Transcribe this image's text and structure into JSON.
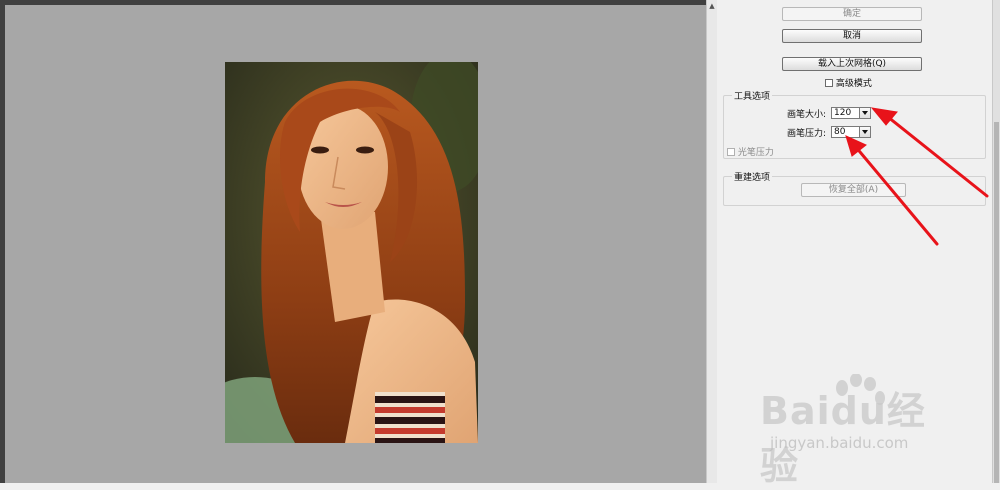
{
  "buttons": {
    "ok": "确定",
    "cancel": "取消",
    "load_mesh": "载入上次网格(Q)"
  },
  "advanced_mode": {
    "label": "高级模式",
    "checked": false
  },
  "tool_options": {
    "title": "工具选项",
    "brush_size": {
      "label": "画笔大小:",
      "value": "120"
    },
    "brush_pressure": {
      "label": "画笔压力:",
      "value": "80"
    },
    "stylus_pressure": {
      "label": "光笔压力",
      "checked": false
    }
  },
  "reconstruct_options": {
    "title": "重建选项",
    "restore_all": "恢复全部(A)"
  },
  "watermark": {
    "logo_text": "Baidu经验",
    "url": "jingyan.baidu.com"
  },
  "colors": {
    "canvas_bg": "#a7a7a7",
    "panel_bg": "#f0f0f0",
    "annotation_red": "#e8131a"
  },
  "icons": {
    "dropdown": "chevron-down-icon",
    "scroll_up": "arrow-up-icon"
  }
}
